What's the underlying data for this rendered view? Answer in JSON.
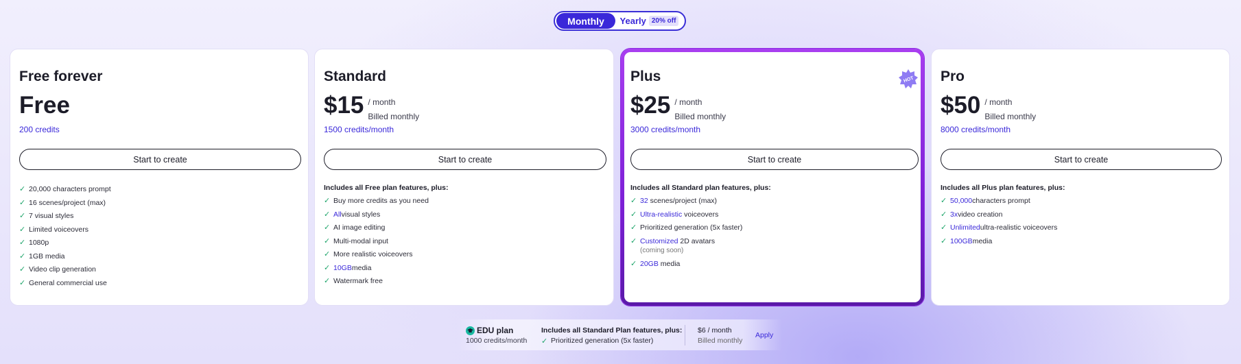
{
  "billing_toggle": {
    "monthly_label": "Monthly",
    "yearly_label": "Yearly",
    "yearly_discount": "20% off",
    "selected": "Monthly"
  },
  "colors": {
    "accent": "#3a28d9",
    "check": "#1fa56b",
    "plus_border": "#8a2be2"
  },
  "plans": [
    {
      "name": "Free forever",
      "price": "Free",
      "per": "",
      "billed": "",
      "credits": "200 credits",
      "cta": "Start to create",
      "features_heading": "",
      "features": [
        {
          "pre": "",
          "hl": "",
          "text": "20,000 characters prompt"
        },
        {
          "pre": "",
          "hl": "",
          "text": "16 scenes/project (max)"
        },
        {
          "pre": "",
          "hl": "",
          "text": "7 visual styles"
        },
        {
          "pre": "",
          "hl": "",
          "text": "Limited voiceovers"
        },
        {
          "pre": "",
          "hl": "",
          "text": "1080p"
        },
        {
          "pre": "",
          "hl": "",
          "text": "1GB media"
        },
        {
          "pre": "",
          "hl": "",
          "text": "Video clip generation"
        },
        {
          "pre": "",
          "hl": "",
          "text": "General commercial use"
        }
      ]
    },
    {
      "name": "Standard",
      "price": "$15",
      "per": "/ month",
      "billed": "Billed monthly",
      "credits": "1500 credits/month",
      "cta": "Start to create",
      "features_heading": "Includes all Free plan features, plus:",
      "features": [
        {
          "hl": "",
          "text": "Buy more credits as you need"
        },
        {
          "hl": "All",
          "text": " visual styles"
        },
        {
          "hl": "",
          "text": "AI image editing"
        },
        {
          "hl": "",
          "text": "Multi-modal input"
        },
        {
          "hl": "",
          "text": "More realistic voiceovers"
        },
        {
          "hl": "10GB",
          "text": " media"
        },
        {
          "hl": "",
          "text": "Watermark free"
        }
      ]
    },
    {
      "name": "Plus",
      "badge": "HOT",
      "price": "$25",
      "per": "/ month",
      "billed": "Billed monthly",
      "credits": "3000 credits/month",
      "cta": "Start to create",
      "features_heading": "Includes all Standard plan features, plus:",
      "features": [
        {
          "hl": "32",
          "text": " scenes/project (max)",
          "sub": ""
        },
        {
          "hl": "Ultra-realistic",
          "text": " voiceovers",
          "sub": ""
        },
        {
          "hl": "",
          "text": "Prioritized generation (5x faster)",
          "sub": ""
        },
        {
          "hl": "Customized",
          "text": " 2D avatars",
          "sub": "(coming soon)"
        },
        {
          "hl": "20GB",
          "text": " media",
          "sub": ""
        }
      ]
    },
    {
      "name": "Pro",
      "price": "$50",
      "per": "/ month",
      "billed": "Billed monthly",
      "credits": "8000 credits/month",
      "cta": "Start to create",
      "features_heading": "Includes all Plus plan features, plus:",
      "features": [
        {
          "hl": "50,000",
          "text": " characters prompt"
        },
        {
          "hl": "3x",
          "text": " video creation"
        },
        {
          "hl": "Unlimited",
          "text": " ultra-realistic voiceovers"
        },
        {
          "hl": "100GB",
          "text": " media"
        }
      ]
    }
  ],
  "edu": {
    "title": "EDU plan",
    "credits_num": "1000",
    "credits_unit": " credits/month",
    "features_heading": "Includes all Standard Plan features, plus:",
    "feature": "Prioritized generation (5x faster)",
    "price": "$6",
    "per": " / month",
    "billed": "Billed monthly",
    "apply": "Apply"
  }
}
